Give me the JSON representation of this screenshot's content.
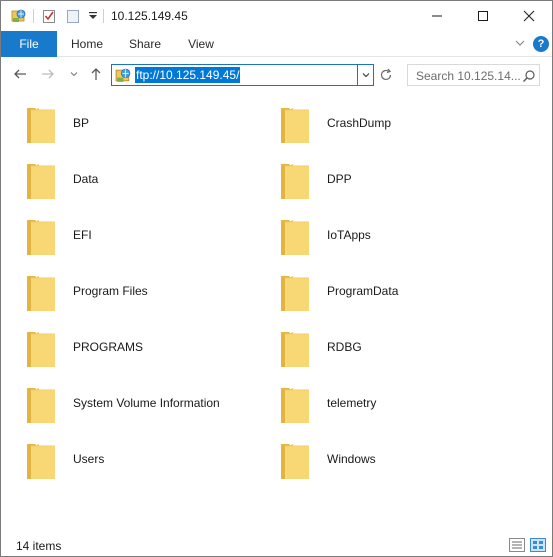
{
  "window": {
    "title": "10.125.149.45"
  },
  "ribbon": {
    "tabs": [
      {
        "label": "File"
      },
      {
        "label": "Home"
      },
      {
        "label": "Share"
      },
      {
        "label": "View"
      }
    ],
    "help_label": "?"
  },
  "navigation": {
    "address_value": "ftp://10.125.149.45/",
    "search_placeholder": "Search 10.125.14..."
  },
  "folders": [
    {
      "name": "BP"
    },
    {
      "name": "CrashDump"
    },
    {
      "name": "Data"
    },
    {
      "name": "DPP"
    },
    {
      "name": "EFI"
    },
    {
      "name": "IoTApps"
    },
    {
      "name": "Program Files"
    },
    {
      "name": "ProgramData"
    },
    {
      "name": "PROGRAMS"
    },
    {
      "name": "RDBG"
    },
    {
      "name": "System Volume Information"
    },
    {
      "name": "telemetry"
    },
    {
      "name": "Users"
    },
    {
      "name": "Windows"
    }
  ],
  "status": {
    "item_count": "14 items"
  },
  "colors": {
    "accent": "#1979ca",
    "selection": "#0078d7",
    "folder_front": "#f8d775",
    "folder_back": "#e2b544"
  },
  "icons": {
    "quick_access": [
      "properties-icon",
      "new-folder-icon",
      "customize-toolbar-icon"
    ],
    "window_controls": [
      "minimize-icon",
      "maximize-icon",
      "close-icon"
    ],
    "navigation": [
      "back-arrow-icon",
      "forward-arrow-icon",
      "recent-locations-icon",
      "up-arrow-icon",
      "address-dropdown-icon",
      "refresh-icon",
      "search-icon"
    ],
    "status": [
      "details-view-icon",
      "large-icons-view-icon"
    ]
  }
}
